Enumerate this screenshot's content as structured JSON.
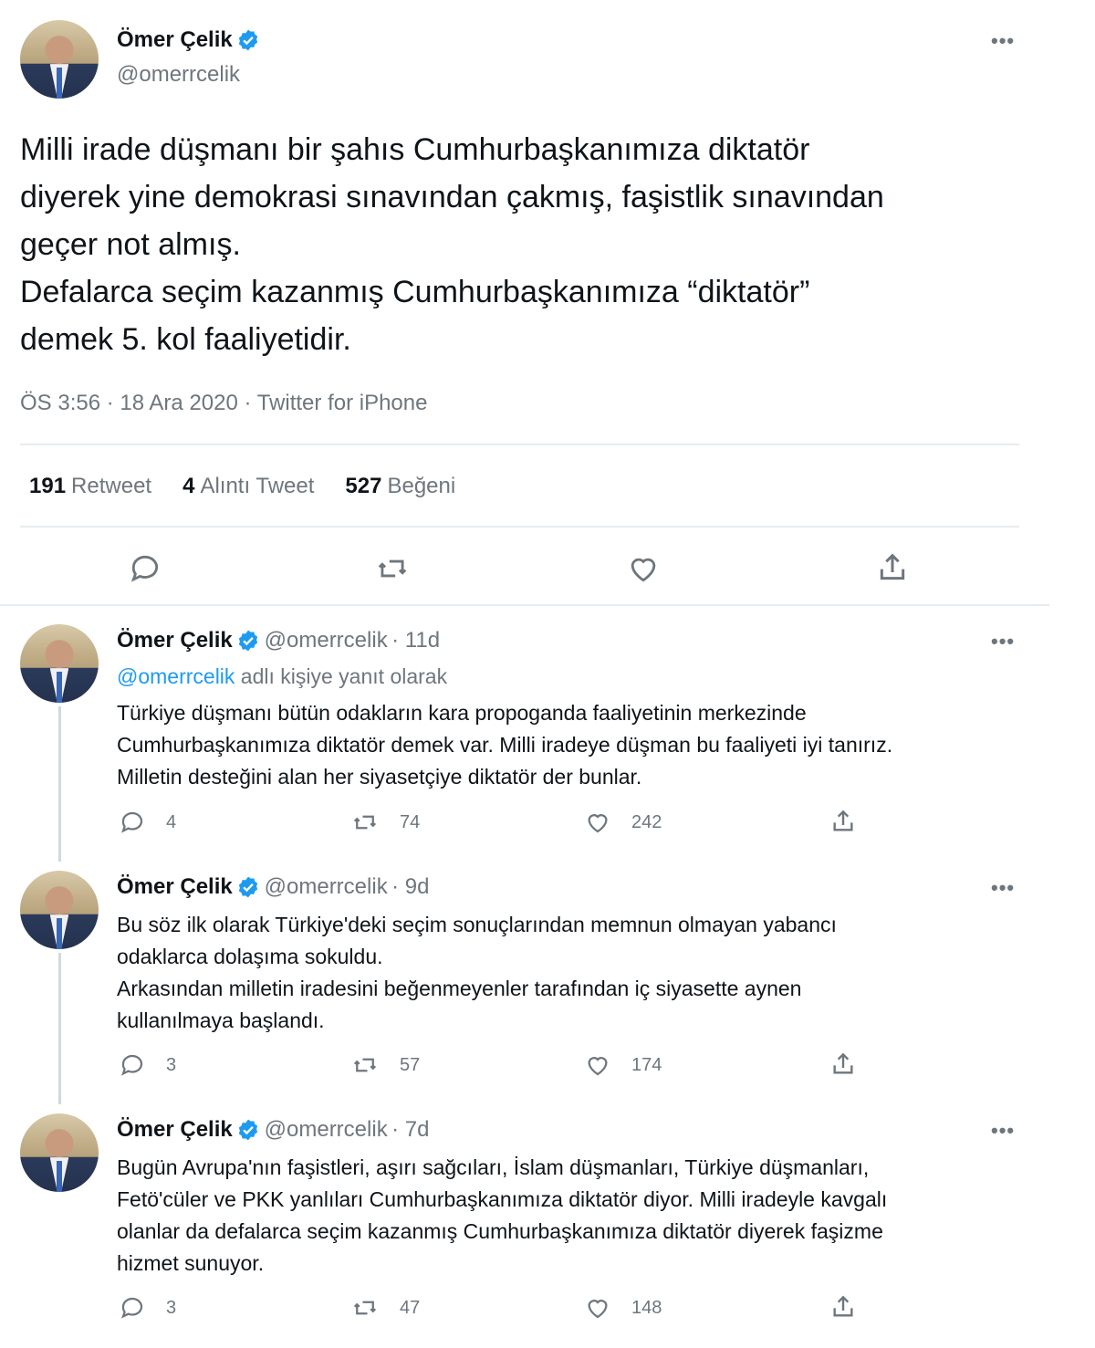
{
  "main_tweet": {
    "author_name": "Ömer Çelik",
    "author_handle": "@omerrcelik",
    "text_lines": [
      "Milli irade düşmanı bir şahıs Cumhurbaşkanımıza diktatör",
      "diyerek yine demokrasi sınavından çakmış, faşistlik sınavından",
      "geçer not almış.",
      "Defalarca seçim kazanmış Cumhurbaşkanımıza “diktatör”",
      "demek 5. kol faaliyetidir."
    ],
    "meta": "ÖS 3:56 · 18 Ara 2020 · Twitter for iPhone",
    "stats": [
      {
        "value": "191",
        "label": "Retweet"
      },
      {
        "value": "4",
        "label": "Alıntı Tweet"
      },
      {
        "value": "527",
        "label": "Beğeni"
      }
    ]
  },
  "replies": [
    {
      "author_name": "Ömer Çelik",
      "author_handle": "@omerrcelik",
      "age": "· 11d",
      "context_mention": "@omerrcelik",
      "context_rest": " adlı kişiye yanıt olarak",
      "text_lines": [
        "Türkiye düşmanı bütün odakların kara propoganda faaliyetinin merkezinde",
        "Cumhurbaşkanımıza diktatör demek var. Milli iradeye düşman bu faaliyeti iyi tanırız.",
        "Milletin desteğini alan her siyasetçiye diktatör der bunlar."
      ],
      "replies_count": "4",
      "retweets_count": "74",
      "likes_count": "242"
    },
    {
      "author_name": "Ömer Çelik",
      "author_handle": "@omerrcelik",
      "age": "· 9d",
      "text_lines": [
        "Bu söz ilk olarak Türkiye'deki seçim sonuçlarından memnun olmayan yabancı",
        "odaklarca dolaşıma sokuldu.",
        "Arkasından milletin iradesini beğenmeyenler tarafından iç siyasette aynen",
        "kullanılmaya başlandı."
      ],
      "replies_count": "3",
      "retweets_count": "57",
      "likes_count": "174"
    },
    {
      "author_name": "Ömer Çelik",
      "author_handle": "@omerrcelik",
      "age": "· 7d",
      "text_lines": [
        "Bugün Avrupa'nın faşistleri, aşırı sağcıları, İslam düşmanları, Türkiye düşmanları,",
        "Fetö'cüler ve PKK yanlıları Cumhurbaşkanımıza diktatör diyor. Milli iradeyle kavgalı",
        "olanlar da defalarca seçim kazanmış Cumhurbaşkanımıza diktatör diyerek faşizme",
        "hizmet sunuyor."
      ],
      "replies_count": "3",
      "retweets_count": "47",
      "likes_count": "148"
    }
  ],
  "icons": {
    "more": "•••",
    "verified_color": "#1d9bf0"
  }
}
